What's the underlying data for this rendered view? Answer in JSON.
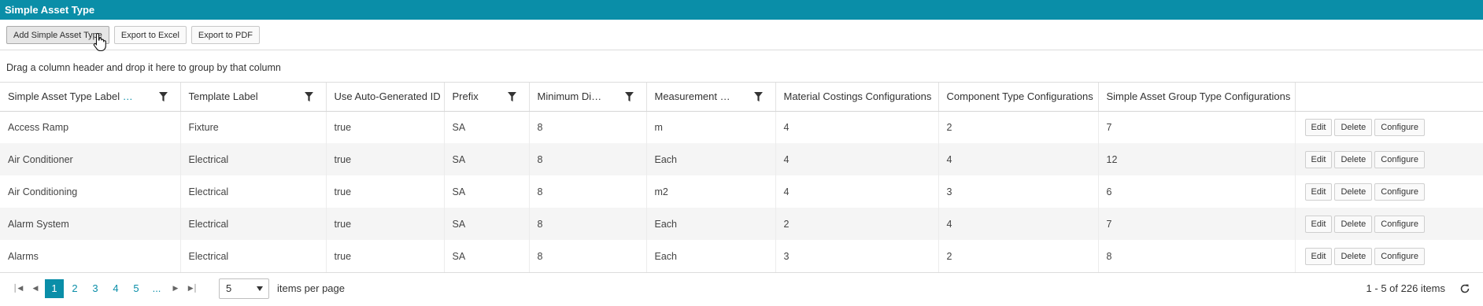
{
  "window": {
    "title": "Simple Asset Type"
  },
  "toolbar": {
    "add_label": "Add Simple Asset Type",
    "excel_label": "Export to Excel",
    "pdf_label": "Export to PDF"
  },
  "grouping": {
    "hint": "Drag a column header and drop it here to group by that column"
  },
  "columns": [
    {
      "label": "Simple Asset Type Label",
      "extra": "…",
      "filter": true
    },
    {
      "label": "Template Label",
      "filter": true
    },
    {
      "label": "Use Auto-Generated ID",
      "filter": false
    },
    {
      "label": "Prefix",
      "filter": true
    },
    {
      "label": "Minimum Di…",
      "filter": true
    },
    {
      "label": "Measurement …",
      "filter": true
    },
    {
      "label": "Material Costings Configurations",
      "filter": false
    },
    {
      "label": "Component Type Configurations",
      "filter": false
    },
    {
      "label": "Simple Asset Group Type Configurations",
      "filter": false
    },
    {
      "label": "",
      "filter": false
    }
  ],
  "rows": [
    [
      "Access Ramp",
      "Fixture",
      "true",
      "SA",
      "8",
      "m",
      "4",
      "2",
      "7"
    ],
    [
      "Air Conditioner",
      "Electrical",
      "true",
      "SA",
      "8",
      "Each",
      "4",
      "4",
      "12"
    ],
    [
      "Air Conditioning",
      "Electrical",
      "true",
      "SA",
      "8",
      "m2",
      "4",
      "3",
      "6"
    ],
    [
      "Alarm System",
      "Electrical",
      "true",
      "SA",
      "8",
      "Each",
      "2",
      "4",
      "7"
    ],
    [
      "Alarms",
      "Electrical",
      "true",
      "SA",
      "8",
      "Each",
      "3",
      "2",
      "8"
    ]
  ],
  "row_actions": {
    "edit": "Edit",
    "delete": "Delete",
    "configure": "Configure"
  },
  "pager": {
    "pages": [
      "1",
      "2",
      "3",
      "4",
      "5",
      "..."
    ],
    "current": "1",
    "page_size": "5",
    "page_size_label": "items per page",
    "info": "1 - 5 of 226 items"
  },
  "colors": {
    "accent": "#0a8ea8"
  },
  "icons": {
    "filter": "filter-funnel-icon",
    "refresh": "refresh-icon",
    "cursor": "hand-pointer-icon"
  }
}
